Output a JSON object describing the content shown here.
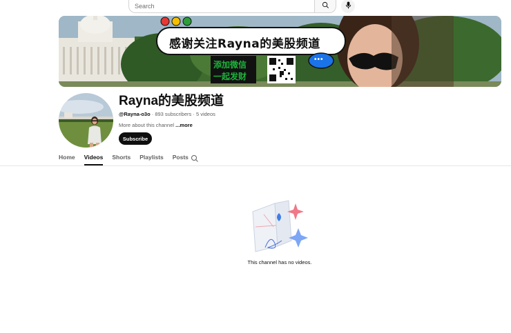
{
  "search": {
    "placeholder": "Search"
  },
  "icons": {
    "search": "search-icon",
    "mic": "microphone-icon",
    "tab_search": "search-icon"
  },
  "banner": {
    "headline": "感谢关注Rayna的美股频道",
    "callout_line1": "添加微信",
    "callout_line2": "一起发财",
    "dots_badge": "•••",
    "colors": {
      "headline_bg": "#ffffff",
      "callout_text": "#1db33a",
      "dots_bg": "#1a73e8"
    }
  },
  "channel": {
    "name": "Rayna的美股频道",
    "handle": "@Rayna-o3o",
    "subscribers": "893 subscribers",
    "videos_count": "5 videos",
    "separator": " · ",
    "about": "More about this channel",
    "more": "...more",
    "subscribe_label": "Subscribe"
  },
  "tabs": [
    {
      "label": "Home",
      "active": false
    },
    {
      "label": "Videos",
      "active": true
    },
    {
      "label": "Shorts",
      "active": false
    },
    {
      "label": "Playlists",
      "active": false
    },
    {
      "label": "Posts",
      "active": false
    }
  ],
  "empty_state": {
    "message": "This channel has no videos."
  }
}
